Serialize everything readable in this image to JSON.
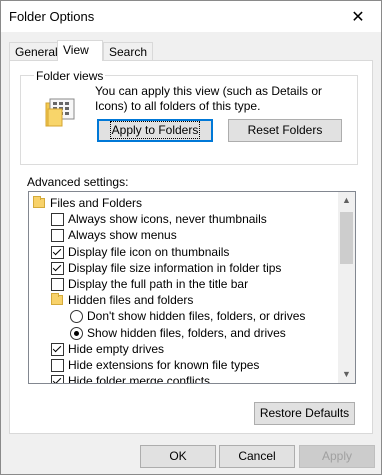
{
  "window": {
    "title": "Folder Options"
  },
  "tabs": [
    "General",
    "View",
    "Search"
  ],
  "folder_views": {
    "group_label": "Folder views",
    "description": "You can apply this view (such as Details or Icons) to all folders of this type.",
    "apply_label": "Apply to Folders",
    "reset_label": "Reset Folders"
  },
  "advanced": {
    "label": "Advanced settings:",
    "items": [
      {
        "type": "folder",
        "label": "Files and Folders"
      },
      {
        "type": "checkbox",
        "label": "Always show icons, never thumbnails",
        "checked": false
      },
      {
        "type": "checkbox",
        "label": "Always show menus",
        "checked": false
      },
      {
        "type": "checkbox",
        "label": "Display file icon on thumbnails",
        "checked": true
      },
      {
        "type": "checkbox",
        "label": "Display file size information in folder tips",
        "checked": true
      },
      {
        "type": "checkbox",
        "label": "Display the full path in the title bar",
        "checked": false
      },
      {
        "type": "folder",
        "label": "Hidden files and folders"
      },
      {
        "type": "radio",
        "label": "Don't show hidden files, folders, or drives",
        "checked": false
      },
      {
        "type": "radio",
        "label": "Show hidden files, folders, and drives",
        "checked": true
      },
      {
        "type": "checkbox",
        "label": "Hide empty drives",
        "checked": true
      },
      {
        "type": "checkbox",
        "label": "Hide extensions for known file types",
        "checked": false
      },
      {
        "type": "checkbox",
        "label": "Hide folder merge conflicts",
        "checked": true
      }
    ],
    "restore_label": "Restore Defaults"
  },
  "footer": {
    "ok": "OK",
    "cancel": "Cancel",
    "apply": "Apply"
  }
}
